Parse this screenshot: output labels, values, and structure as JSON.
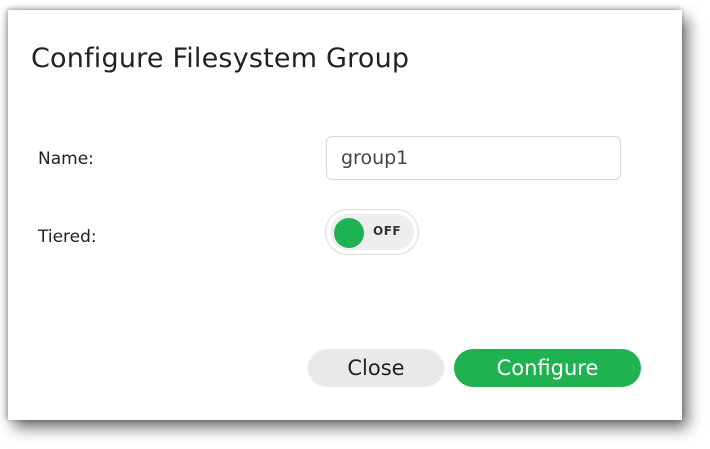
{
  "dialog": {
    "title": "Configure Filesystem Group",
    "fields": {
      "name_label": "Name:",
      "name_value": "group1",
      "tiered_label": "Tiered:",
      "tiered_state": "OFF"
    },
    "buttons": {
      "close_label": "Close",
      "configure_label": "Configure"
    }
  },
  "colors": {
    "accent_green": "#1fb250",
    "secondary_button": "#e9e9e9",
    "text": "#222222"
  }
}
